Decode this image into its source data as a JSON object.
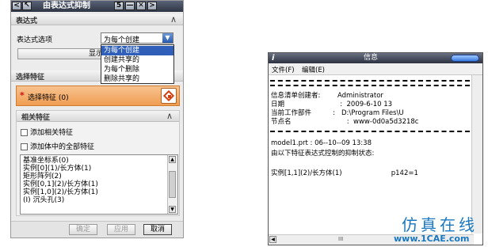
{
  "dialog": {
    "title": "由表达式抑制",
    "title_controls": [
      "<",
      "↖",
      "5",
      "—",
      "✕",
      ">"
    ],
    "expression_section": {
      "header": "表达式",
      "option_label": "表达式选项",
      "selected_value": "为每个创建",
      "options": [
        "为每个创建",
        "创建共享的",
        "为每个删除",
        "删除共享的"
      ],
      "show_button": "显示表"
    },
    "select_section": {
      "header": "选择特征",
      "select_label": "选择特征 (0)"
    },
    "related_section": {
      "header": "相关特征",
      "checkbox_add_related": "添加相关特征",
      "checkbox_add_all_in_body": "添加体中的全部特征",
      "features": [
        "基准坐标系(0)",
        "实例[0](1)/长方体(1)",
        "矩形阵列(2)",
        "实例[0,1](2)/长方体(1)",
        "实例[1,0](2)/长方体(1)",
        "(I) 沉头孔(3)"
      ]
    },
    "footer": {
      "ok": "确定",
      "apply": "应用",
      "cancel": "取消"
    }
  },
  "info_window": {
    "title": "信息",
    "icon_letter": "i",
    "menu": [
      "文件(F)",
      "编辑(E)"
    ],
    "lines": [
      "信息清单创建者:        Administrator",
      "日期                          :  2009-6-10 13",
      "当前工作部件          :   D:\\Program Files\\U",
      "节点名                          :  www-0d0a5d3218c",
      "model1.prt : 06--10--09 13:38",
      "由以下特征表达式控制的抑制状态:",
      "实例[1,1](2)/长方体(1)                       p142=1"
    ],
    "hscroll_grip": "III"
  },
  "watermark": {
    "text": "仿真在线",
    "url": "www.1CAE.com"
  }
}
